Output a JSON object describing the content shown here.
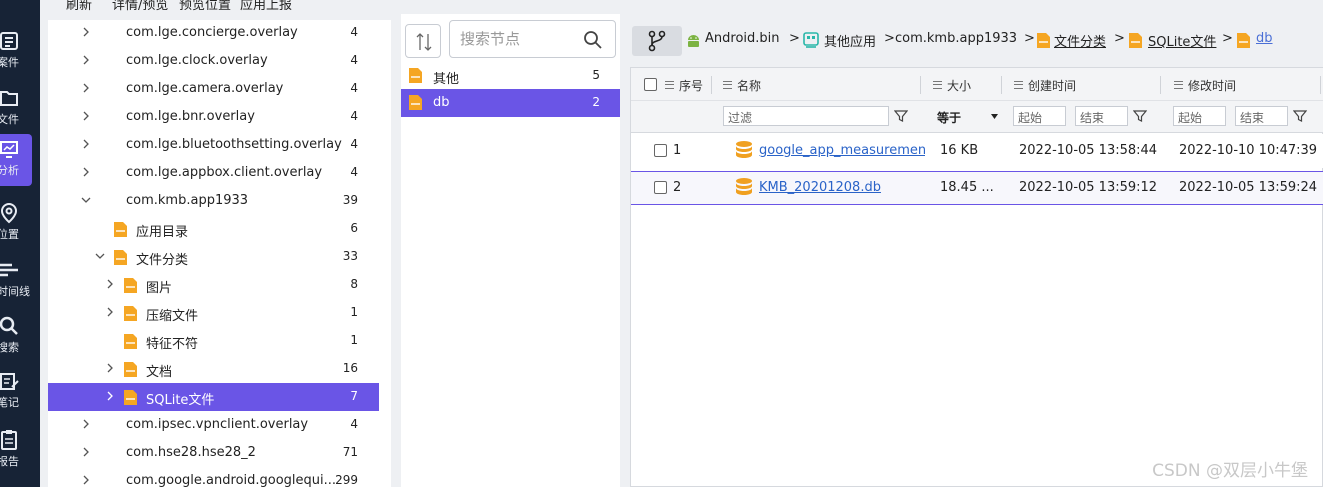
{
  "rail": {
    "items": [
      {
        "label": "案件",
        "icon": "case-icon"
      },
      {
        "label": "文件",
        "icon": "folder-icon"
      },
      {
        "label": "分析",
        "icon": "analysis-icon"
      },
      {
        "label": "位置",
        "icon": "location-icon"
      },
      {
        "label": "时间线",
        "icon": "timeline-icon"
      },
      {
        "label": "搜索",
        "icon": "search-icon"
      },
      {
        "label": "笔记",
        "icon": "notes-icon"
      },
      {
        "label": "报告",
        "icon": "report-icon"
      }
    ]
  },
  "toolbar": {
    "refresh": "刷新",
    "detail_preview": "详情/预览",
    "preview_position": "预览位置",
    "app_report": "应用上报"
  },
  "tree": {
    "rows": [
      {
        "name": "com.lge.concierge.overlay",
        "count": "4"
      },
      {
        "name": "com.lge.clock.overlay",
        "count": "4"
      },
      {
        "name": "com.lge.camera.overlay",
        "count": "4"
      },
      {
        "name": "com.lge.bnr.overlay",
        "count": "4"
      },
      {
        "name": "com.lge.bluetoothsetting.overlay",
        "count": "4"
      },
      {
        "name": "com.lge.appbox.client.overlay",
        "count": "4"
      },
      {
        "name": "com.kmb.app1933",
        "count": "39"
      },
      {
        "name": "应用目录",
        "count": "6"
      },
      {
        "name": "文件分类",
        "count": "33"
      },
      {
        "name": "图片",
        "count": "8"
      },
      {
        "name": "压缩文件",
        "count": "1"
      },
      {
        "name": "特征不符",
        "count": "1"
      },
      {
        "name": "文档",
        "count": "16"
      },
      {
        "name": "SQLite文件",
        "count": "7"
      },
      {
        "name": "com.ipsec.vpnclient.overlay",
        "count": "4"
      },
      {
        "name": "com.hse28.hse28_2",
        "count": "71"
      },
      {
        "name": "com.google.android.googlequi...",
        "count": "299"
      }
    ]
  },
  "middle": {
    "search_placeholder": "搜索节点",
    "rows": [
      {
        "name": "其他",
        "count": "5"
      },
      {
        "name": "db",
        "count": "2"
      }
    ]
  },
  "breadcrumb": {
    "items": [
      "Android.bin",
      "其他应用",
      "com.kmb.app1933",
      "文件分类",
      "SQLite文件",
      "db"
    ],
    "sep": ">"
  },
  "table": {
    "headers": {
      "index": "序号",
      "name": "名称",
      "size": "大小",
      "created": "创建时间",
      "modified": "修改时间"
    },
    "filter": {
      "name_placeholder": "过滤",
      "size_op": "等于",
      "created_start": "起始",
      "created_end": "结束",
      "modified_start": "起始",
      "modified_end": "结束"
    },
    "rows": [
      {
        "index": "1",
        "name": "google_app_measurement_",
        "size": "16 KB",
        "created": "2022-10-05 13:58:44",
        "modified": "2022-10-10 10:47:39"
      },
      {
        "index": "2",
        "name": "KMB_20201208.db",
        "size": "18.45 ...",
        "created": "2022-10-05 13:59:12",
        "modified": "2022-10-05 13:59:24"
      }
    ]
  },
  "watermark": "CSDN @双层小牛堡",
  "colors": {
    "accent": "#6a55e6",
    "rail": "#172336",
    "folder": "#f5a623",
    "db": "#f0a020",
    "link": "#2a63c8"
  }
}
